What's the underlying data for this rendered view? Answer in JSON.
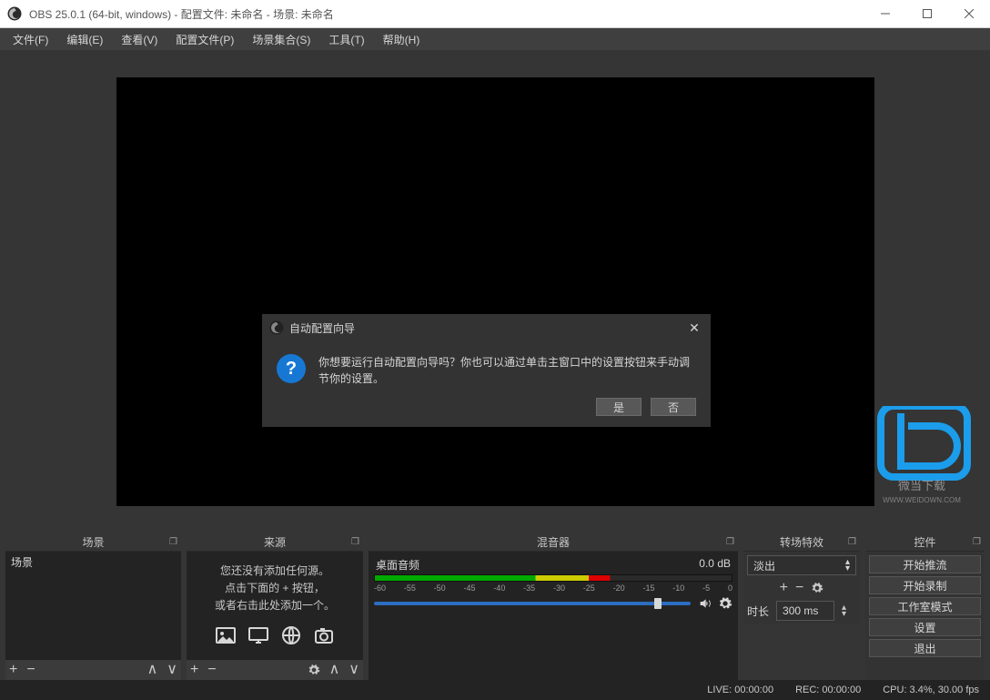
{
  "window": {
    "title": "OBS 25.0.1 (64-bit, windows) - 配置文件: 未命名 - 场景: 未命名"
  },
  "menu": {
    "file": "文件(F)",
    "edit": "编辑(E)",
    "view": "查看(V)",
    "profile": "配置文件(P)",
    "scene_collection": "场景集合(S)",
    "tools": "工具(T)",
    "help": "帮助(H)"
  },
  "docks": {
    "scenes": {
      "title": "场景",
      "item": "场景"
    },
    "sources": {
      "title": "来源",
      "hint_line1": "您还没有添加任何源。",
      "hint_line2": "点击下面的 + 按钮，",
      "hint_line3": "或者右击此处添加一个。"
    },
    "mixer": {
      "title": "混音器",
      "channel": "桌面音频",
      "level": "0.0 dB",
      "ticks": [
        "-60",
        "-55",
        "-50",
        "-45",
        "-40",
        "-35",
        "-30",
        "-25",
        "-20",
        "-15",
        "-10",
        "-5",
        "0"
      ]
    },
    "transitions": {
      "title": "转场特效",
      "selected": "淡出",
      "duration_label": "时长",
      "duration_value": "300 ms"
    },
    "controls": {
      "title": "控件",
      "start_stream": "开始推流",
      "start_record": "开始录制",
      "studio_mode": "工作室模式",
      "settings": "设置",
      "exit": "退出"
    }
  },
  "status": {
    "live": "LIVE: 00:00:00",
    "rec": "REC: 00:00:00",
    "cpu": "CPU: 3.4%, 30.00 fps"
  },
  "dialog": {
    "title": "自动配置向导",
    "message": "你想要运行自动配置向导吗？你也可以通过单击主窗口中的设置按钮来手动调节你的设置。",
    "yes": "是",
    "no": "否"
  },
  "watermark": {
    "line1": "微当下载",
    "line2": "WWW.WEIDOWN.COM"
  }
}
